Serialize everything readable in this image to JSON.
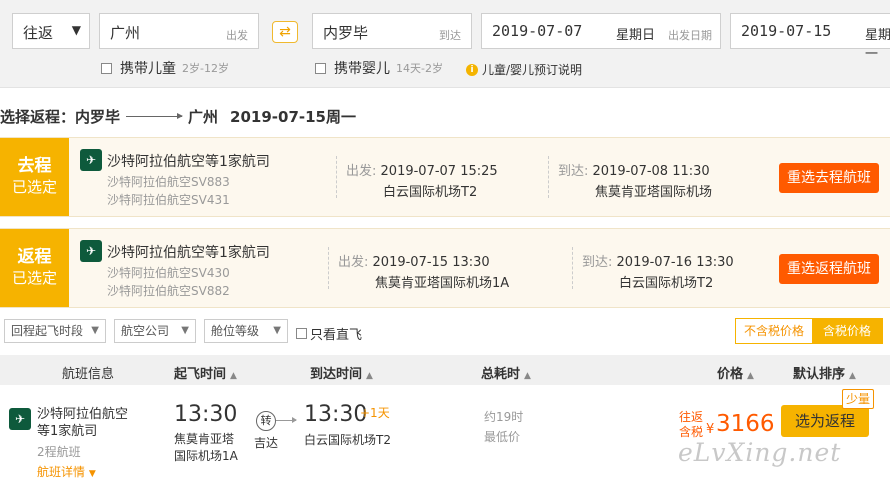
{
  "search": {
    "trip_type": "往返",
    "from_city": "广州",
    "from_suffix": "出发",
    "to_city": "内罗毕",
    "to_suffix": "到达",
    "depart_date": "2019-07-07",
    "depart_weekday": "星期日",
    "depart_suffix": "出发日期",
    "return_date": "2019-07-15",
    "return_weekday": "星期一",
    "child_label": "携带儿童",
    "child_hint": "2岁-12岁",
    "infant_label": "携带婴儿",
    "infant_hint": "14天-2岁",
    "info_label": "儿童/婴儿预订说明"
  },
  "selection": {
    "prefix": "选择返程：",
    "from": "内罗毕",
    "to": "广州",
    "date": "2019-07-15周一"
  },
  "legs": [
    {
      "tag1": "去程",
      "tag2": "已选定",
      "airline": "沙特阿拉伯航空等1家航司",
      "flight1": "沙特阿拉伯航空SV883",
      "flight2": "沙特阿拉伯航空SV431",
      "dep_label": "出发:",
      "dep_time": "2019-07-07 15:25",
      "dep_airport": "白云国际机场T2",
      "arr_label": "到达:",
      "arr_time": "2019-07-08 11:30",
      "arr_airport": "焦莫肯亚塔国际机场",
      "reselect": "重选去程航班"
    },
    {
      "tag1": "返程",
      "tag2": "已选定",
      "airline": "沙特阿拉伯航空等1家航司",
      "flight1": "沙特阿拉伯航空SV430",
      "flight2": "沙特阿拉伯航空SV882",
      "dep_label": "出发:",
      "dep_time": "2019-07-15 13:30",
      "dep_airport": "焦莫肯亚塔国际机场1A",
      "arr_label": "到达:",
      "arr_time": "2019-07-16 13:30",
      "arr_airport": "白云国际机场T2",
      "reselect": "重选返程航班"
    }
  ],
  "filters": {
    "return_time": "回程起飞时段",
    "airline": "航空公司",
    "cabin": "舱位等级",
    "direct_only": "只看直飞",
    "excl_tax": "不含税价格",
    "incl_tax": "含税价格"
  },
  "table_header": {
    "flight_info": "航班信息",
    "depart_time": "起飞时间",
    "arrive_time": "到达时间",
    "total_time": "总耗时",
    "price": "价格",
    "default_sort": "默认排序"
  },
  "flight_row": {
    "logo_text": "✈",
    "airline": "沙特阿拉伯航空等1家航司",
    "legs": "2程航班",
    "details": "航班详情",
    "depart_time": "13:30",
    "depart_airport": "焦莫肯亚塔国际机场1A",
    "stop_badge": "转",
    "stop_city": "吉达",
    "arrive_time": "13:30",
    "arrive_plus": "+1天",
    "arrive_airport": "白云国际机场T2",
    "duration": "约19时",
    "lowest": "最低价",
    "price_label1": "往返",
    "price_label2": "含税",
    "currency": "¥",
    "price": "3166",
    "choose": "选为返程",
    "few_seats": "少量"
  },
  "watermark": "eLvXing.net",
  "colors": {
    "accent_yellow": "#f6b300",
    "accent_orange": "#ff5a00",
    "leg_bg": "#fdf8ee",
    "airline_green": "#0e5a3c"
  }
}
